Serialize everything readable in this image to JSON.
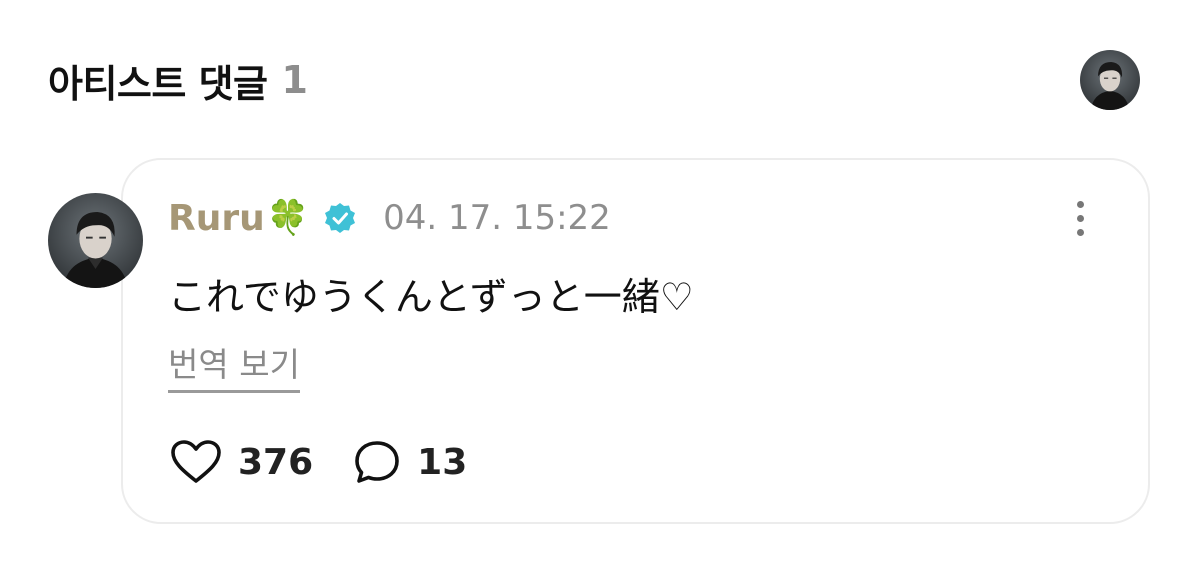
{
  "header": {
    "title": "아티스트 댓글",
    "count": "1",
    "avatar_icon": "profile-avatar"
  },
  "comment": {
    "author": "Ruru",
    "author_emoji": "🍀",
    "author_color": "#a69776",
    "verified_icon": "verified-badge-icon",
    "verified_color": "#3fc1d6",
    "timestamp": "04. 17. 15:22",
    "body": "これでゆうくんとずっと一緒♡",
    "translate_label": "번역 보기",
    "likes": "376",
    "replies": "13",
    "like_icon": "heart-outline-icon",
    "reply_icon": "speech-bubble-icon",
    "more_icon": "vertical-ellipsis-icon"
  }
}
